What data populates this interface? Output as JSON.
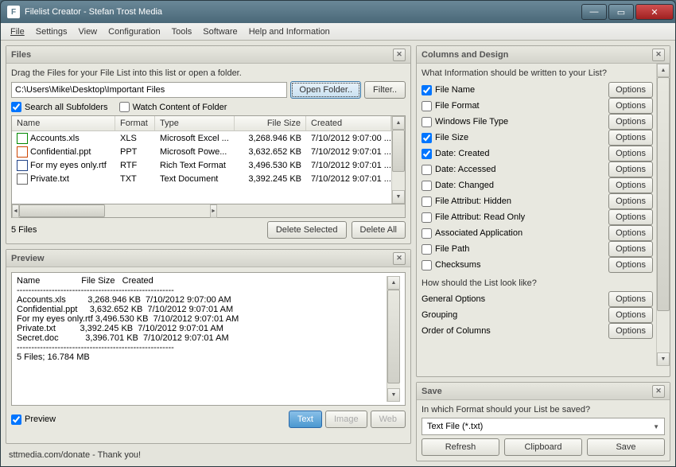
{
  "window": {
    "title": "Filelist Creator - Stefan Trost Media"
  },
  "menu": [
    "File",
    "Settings",
    "View",
    "Configuration",
    "Tools",
    "Software",
    "Help and Information"
  ],
  "files": {
    "title": "Files",
    "hint": "Drag the Files for your File List into this list or open a folder.",
    "path": "C:\\Users\\Mike\\Desktop\\Important Files",
    "open_btn": "Open Folder..",
    "filter_btn": "Filter..",
    "search_sub": "Search all Subfolders",
    "watch": "Watch Content of Folder",
    "cols": {
      "name": "Name",
      "fmt": "Format",
      "type": "Type",
      "size": "File Size",
      "created": "Created"
    },
    "rows": [
      {
        "name": "Accounts.xls",
        "fmt": "XLS",
        "type": "Microsoft Excel ...",
        "size": "3,268.946 KB",
        "created": "7/10/2012 9:07:00 ..."
      },
      {
        "name": "Confidential.ppt",
        "fmt": "PPT",
        "type": "Microsoft Powe...",
        "size": "3,632.652 KB",
        "created": "7/10/2012 9:07:01 ..."
      },
      {
        "name": "For my eyes only.rtf",
        "fmt": "RTF",
        "type": "Rich Text Format",
        "size": "3,496.530 KB",
        "created": "7/10/2012 9:07:01 ..."
      },
      {
        "name": "Private.txt",
        "fmt": "TXT",
        "type": "Text Document",
        "size": "3,392.245 KB",
        "created": "7/10/2012 9:07:01 ..."
      }
    ],
    "count": "5 Files",
    "del_sel": "Delete Selected",
    "del_all": "Delete All"
  },
  "preview": {
    "title": "Preview",
    "text": "Name                 File Size   Created\n------------------------------------------------------\nAccounts.xls         3,268.946 KB  7/10/2012 9:07:00 AM\nConfidential.ppt     3,632.652 KB  7/10/2012 9:07:01 AM\nFor my eyes only.rtf 3,496.530 KB  7/10/2012 9:07:01 AM\nPrivate.txt          3,392.245 KB  7/10/2012 9:07:01 AM\nSecret.doc           3,396.701 KB  7/10/2012 9:07:01 AM\n------------------------------------------------------\n5 Files; 16.784 MB",
    "chk": "Preview",
    "btn_text": "Text",
    "btn_image": "Image",
    "btn_web": "Web"
  },
  "columns": {
    "title": "Columns and Design",
    "hint": "What Information should be written to your List?",
    "items": [
      {
        "label": "File Name",
        "checked": true
      },
      {
        "label": "File Format",
        "checked": false
      },
      {
        "label": "Windows File Type",
        "checked": false
      },
      {
        "label": "File Size",
        "checked": true
      },
      {
        "label": "Date: Created",
        "checked": true
      },
      {
        "label": "Date: Accessed",
        "checked": false
      },
      {
        "label": "Date: Changed",
        "checked": false
      },
      {
        "label": "File Attribut: Hidden",
        "checked": false
      },
      {
        "label": "File Attribut: Read Only",
        "checked": false
      },
      {
        "label": "Associated Application",
        "checked": false
      },
      {
        "label": "File Path",
        "checked": false
      },
      {
        "label": "Checksums",
        "checked": false
      }
    ],
    "opt_label": "Options",
    "sect2": "How should the List look like?",
    "extras": [
      "General Options",
      "Grouping",
      "Order of Columns"
    ]
  },
  "save": {
    "title": "Save",
    "hint": "In which Format should your List be saved?",
    "format": "Text File (*.txt)",
    "refresh": "Refresh",
    "clipboard": "Clipboard",
    "savebtn": "Save"
  },
  "status": "sttmedia.com/donate - Thank you!"
}
